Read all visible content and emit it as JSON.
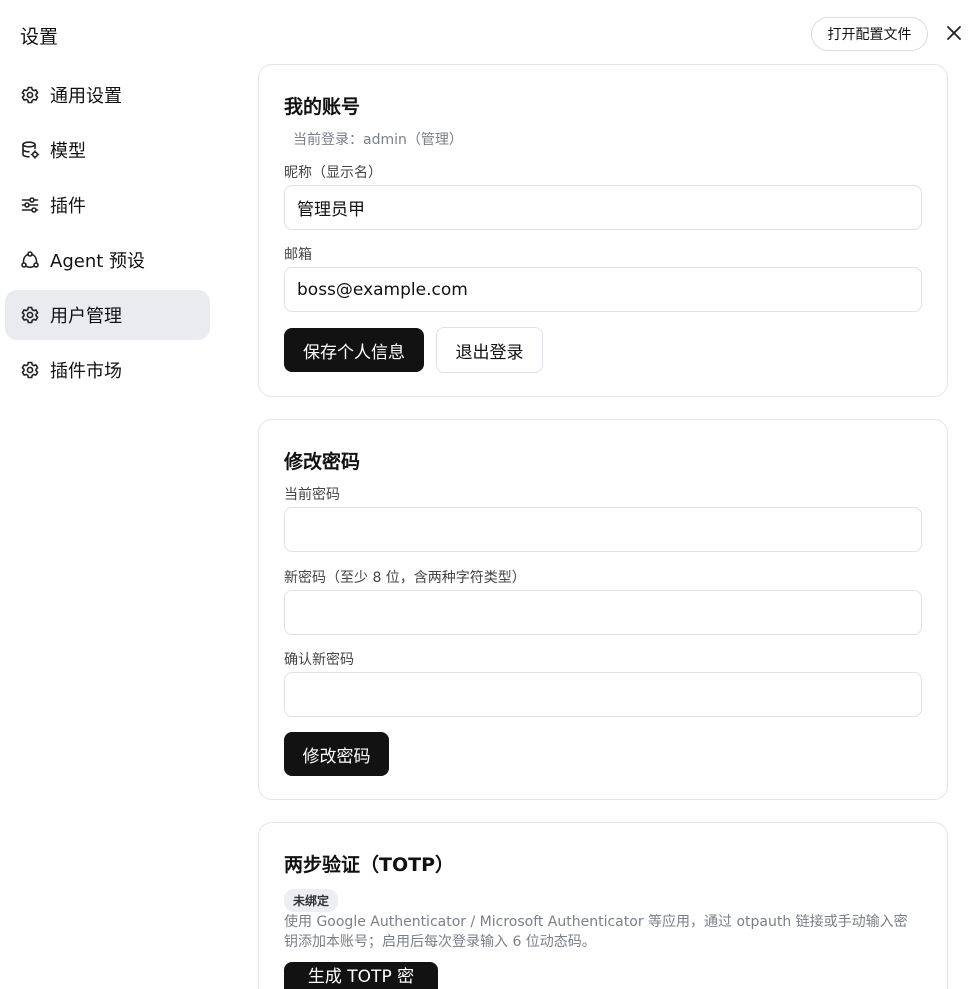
{
  "window": {
    "title": "设置"
  },
  "header": {
    "open_config_label": "打开配置文件"
  },
  "sidebar": {
    "items": [
      {
        "label": "通用设置",
        "icon": "gear-icon"
      },
      {
        "label": "模型",
        "icon": "database-icon"
      },
      {
        "label": "插件",
        "icon": "sliders-icon"
      },
      {
        "label": "Agent 预设",
        "icon": "agent-icon"
      },
      {
        "label": "用户管理",
        "icon": "gear-icon",
        "active": true
      },
      {
        "label": "插件市场",
        "icon": "gear-icon"
      }
    ]
  },
  "account": {
    "title": "我的账号",
    "login_info": "当前登录：admin（管理）",
    "nickname_label": "昵称（显示名）",
    "nickname_value": "管理员甲",
    "email_label": "邮箱",
    "email_value": "boss@example.com",
    "save_label": "保存个人信息",
    "logout_label": "退出登录"
  },
  "password": {
    "title": "修改密码",
    "current_label": "当前密码",
    "current_value": "",
    "new_label": "新密码（至少 8 位，含两种字符类型）",
    "new_value": "",
    "confirm_label": "确认新密码",
    "confirm_value": "",
    "submit_label": "修改密码"
  },
  "totp": {
    "title": "两步验证（TOTP）",
    "status_badge": "未绑定",
    "description": "使用 Google Authenticator / Microsoft Authenticator 等应用，通过 otpauth 链接或手动输入密钥添加本账号；启用后每次登录输入 6 位动态码。",
    "generate_label": "生成 TOTP 密钥"
  }
}
